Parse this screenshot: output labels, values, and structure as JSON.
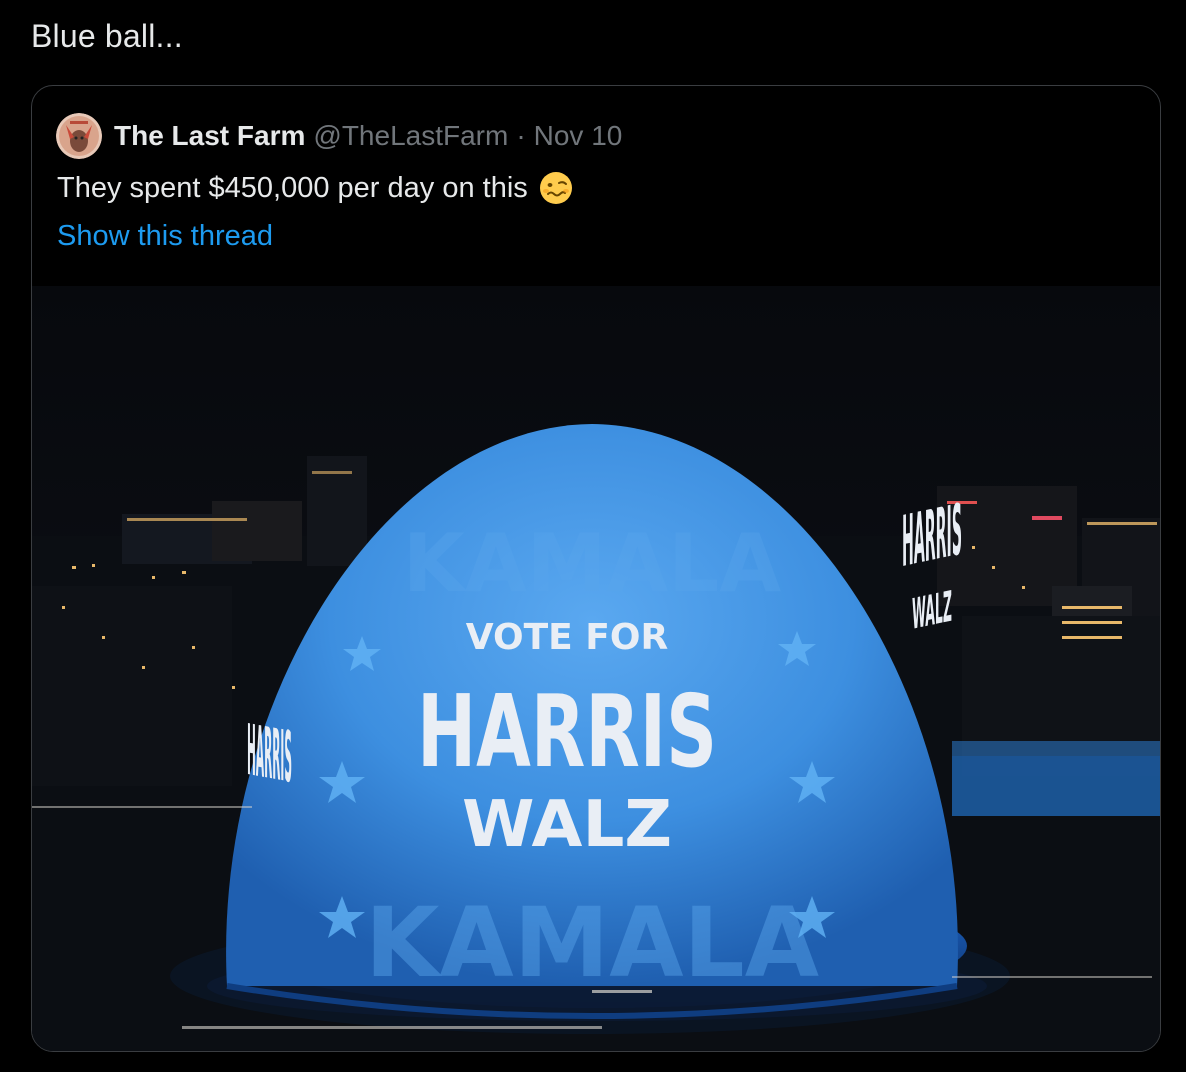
{
  "tweet": {
    "text": "Blue ball..."
  },
  "quoted_tweet": {
    "author_name": "The Last Farm",
    "author_handle": "@TheLastFarm",
    "separator": "·",
    "date": "Nov 10",
    "text": "They spent $450,000 per day on this",
    "emoji": "woozy-face",
    "show_thread_label": "Show this thread",
    "link_color": "#1d9bf0"
  },
  "media": {
    "vote_for": "VOTE FOR",
    "harris": "HARRIS",
    "walz": "WALZ",
    "background_word": "KAMALA",
    "sphere_color": "#3d8fe0"
  }
}
